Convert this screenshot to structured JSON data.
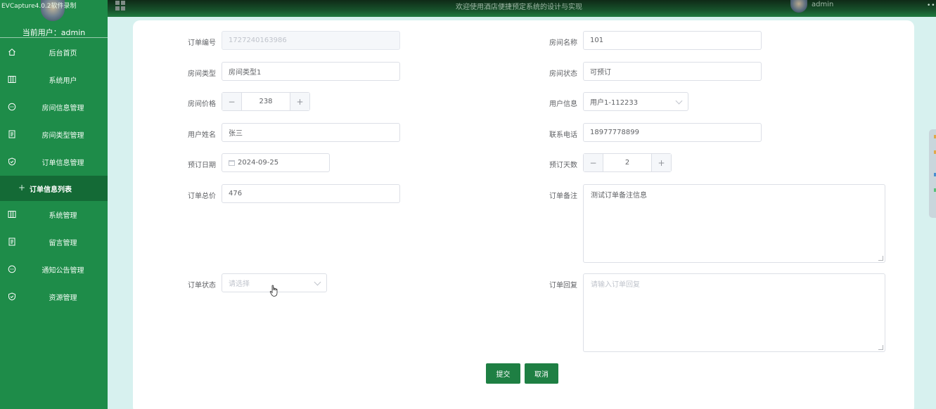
{
  "topbar": {
    "recorder_label": "EVCapture4.0.2软件录制",
    "title": "欢迎使用酒店便捷预定系统的设计与实现",
    "username": "admin"
  },
  "sidebar": {
    "current_user": "当前用户：admin",
    "items": [
      {
        "label": "后台首页",
        "icon": "home-icon"
      },
      {
        "label": "系统用户",
        "icon": "columns-icon"
      },
      {
        "label": "房间信息管理",
        "icon": "chat-icon"
      },
      {
        "label": "房间类型管理",
        "icon": "document-icon"
      },
      {
        "label": "订单信息管理",
        "icon": "shield-icon"
      },
      {
        "label": "订单信息列表",
        "icon": "plus-icon",
        "active": true
      },
      {
        "label": "系统管理",
        "icon": "columns-icon"
      },
      {
        "label": "留言管理",
        "icon": "document-icon"
      },
      {
        "label": "通知公告管理",
        "icon": "chat-icon"
      },
      {
        "label": "资源管理",
        "icon": "shield-icon"
      }
    ]
  },
  "form": {
    "order_no": {
      "label": "订单编号",
      "value": "1727240163986"
    },
    "room_name": {
      "label": "房间名称",
      "value": "101"
    },
    "room_type": {
      "label": "房间类型",
      "value": "房间类型1"
    },
    "room_status": {
      "label": "房间状态",
      "value": "可预订"
    },
    "room_price": {
      "label": "房间价格",
      "value": "238"
    },
    "user_info": {
      "label": "用户信息",
      "value": "用户1-112233"
    },
    "user_name": {
      "label": "用户姓名",
      "value": "张三"
    },
    "phone": {
      "label": "联系电话",
      "value": "18977778899"
    },
    "book_date": {
      "label": "预订日期",
      "value": "2024-09-25"
    },
    "book_days": {
      "label": "预订天数",
      "value": "2"
    },
    "total_price": {
      "label": "订单总价",
      "value": "476"
    },
    "remark": {
      "label": "订单备注",
      "value": "测试订单备注信息"
    },
    "order_status": {
      "label": "订单状态",
      "placeholder": "请选择"
    },
    "reply": {
      "label": "订单回复",
      "placeholder": "请输入订单回复"
    },
    "stepper_minus": "−",
    "stepper_plus": "+"
  },
  "buttons": {
    "submit": "提交",
    "cancel": "取消"
  },
  "colors": {
    "sidebar": "#1e8c49",
    "sidebar_active": "#146a36",
    "primary_button": "#1e7f43",
    "page_background": "#d7f1ef"
  }
}
